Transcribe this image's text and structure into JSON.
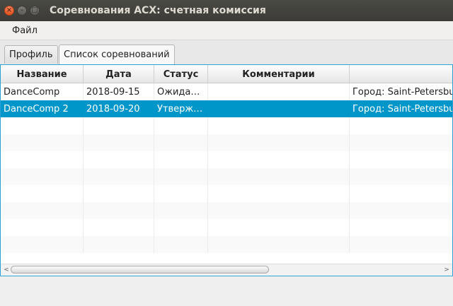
{
  "window": {
    "title": "Соревнования АСХ: счетная комиссия",
    "close_glyph": "×",
    "min_glyph": "–",
    "max_glyph": "□"
  },
  "menu": {
    "items": [
      "Файл"
    ]
  },
  "tabs": [
    {
      "label": "Профиль",
      "selected": false
    },
    {
      "label": "Список соревнований",
      "selected": true
    }
  ],
  "table": {
    "columns": [
      "Название",
      "Дата",
      "Статус",
      "Комментарии",
      ""
    ],
    "rows": [
      [
        "DanceComp",
        "2018-09-15",
        "Ожида…",
        "",
        "Город: Saint-Petersburg"
      ],
      [
        "DanceComp 2",
        "2018-09-20",
        "Утверж…",
        "",
        "Город: Saint-Petersburg"
      ]
    ],
    "selected_row": 1,
    "selection_color": "#0096c9"
  },
  "scrollbar": {
    "left_glyph": "<",
    "right_glyph": ">"
  }
}
